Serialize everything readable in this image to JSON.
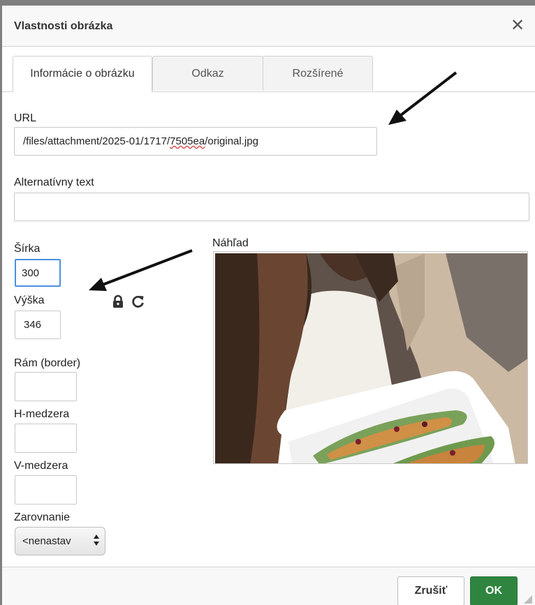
{
  "dialog": {
    "title": "Vlastnosti obrázka",
    "close_symbol": "✕"
  },
  "tabs": [
    {
      "label": "Informácie o obrázku",
      "active": true
    },
    {
      "label": "Odkaz",
      "active": false
    },
    {
      "label": "Rozšírené",
      "active": false
    }
  ],
  "form": {
    "url_label": "URL",
    "url_value_prefix": "/files/attachment/2025-01/1717/",
    "url_value_spell": "7505ea",
    "url_value_suffix": "/original.jpg",
    "alt_label": "Alternatívny text",
    "alt_value": "",
    "width_label": "Šírka",
    "width_value": "300",
    "height_label": "Výška",
    "height_value": "346",
    "border_label": "Rám (border)",
    "border_value": "",
    "hspace_label": "H-medzera",
    "hspace_value": "",
    "vspace_label": "V-medzera",
    "vspace_value": "",
    "align_label": "Zarovnanie",
    "align_value": "<nenastav"
  },
  "preview": {
    "label": "Náhľad"
  },
  "icons": {
    "lock": "lock-icon",
    "reset": "reset-size-icon"
  },
  "footer": {
    "cancel_label": "Zrušiť",
    "ok_label": "OK"
  },
  "colors": {
    "ok_button": "#2f8540",
    "focus_border": "#4a90e2"
  }
}
